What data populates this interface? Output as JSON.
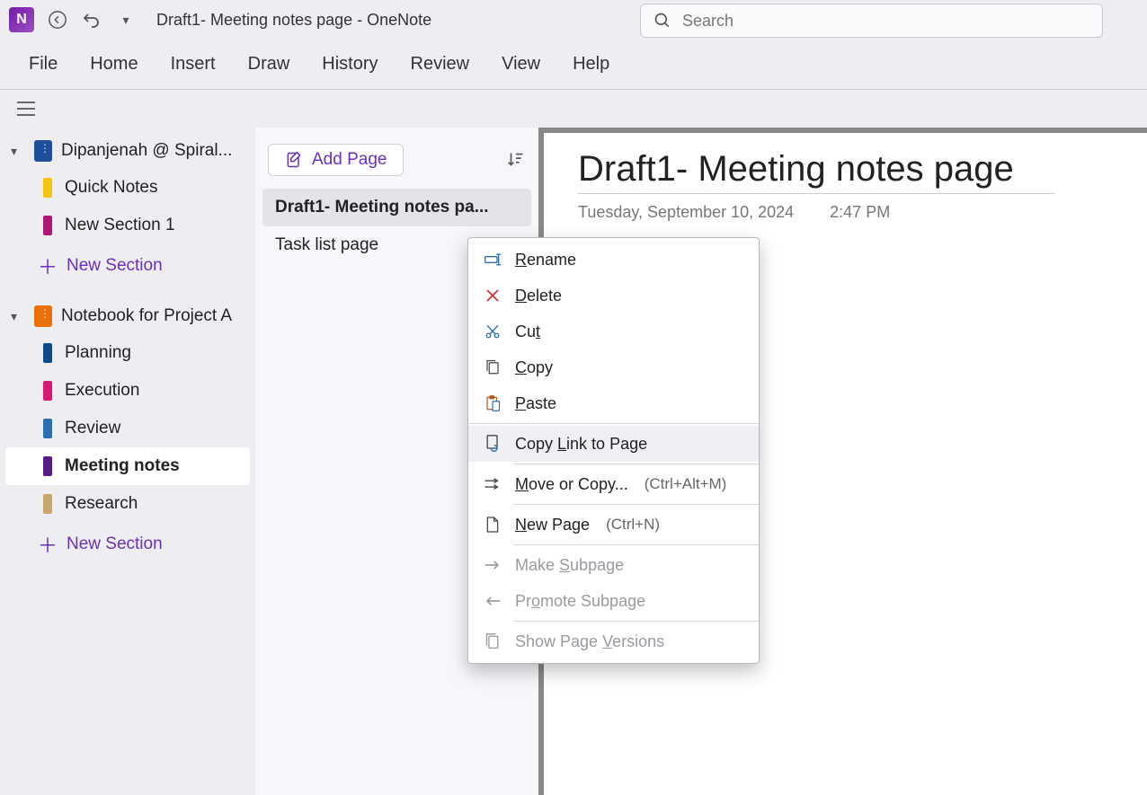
{
  "app": {
    "title": "Draft1- Meeting notes page  -  OneNote"
  },
  "search": {
    "placeholder": "Search"
  },
  "menu": {
    "file": "File",
    "home": "Home",
    "insert": "Insert",
    "draw": "Draw",
    "history": "History",
    "review": "Review",
    "view": "View",
    "help": "Help"
  },
  "sidebar": {
    "notebooks": [
      {
        "name": "Dipanjenah @ Spiral...",
        "color": "#1e4e9c",
        "sections": [
          {
            "label": "Quick Notes",
            "color": "#f2c511"
          },
          {
            "label": "New Section 1",
            "color": "#b01578"
          }
        ]
      },
      {
        "name": "Notebook for Project A",
        "color": "#e8710a",
        "sections": [
          {
            "label": "Planning",
            "color": "#0a4b8a"
          },
          {
            "label": "Execution",
            "color": "#d61a73"
          },
          {
            "label": "Review",
            "color": "#2b6fb3"
          },
          {
            "label": "Meeting notes",
            "color": "#5a1a8a",
            "selected": true
          },
          {
            "label": "Research",
            "color": "#c9a66b"
          }
        ]
      }
    ],
    "new_section": "New Section"
  },
  "pagelist": {
    "add_page": "Add Page",
    "pages": [
      {
        "label": "Draft1- Meeting notes pa...",
        "selected": true
      },
      {
        "label": "Task list page"
      }
    ]
  },
  "page": {
    "title": "Draft1- Meeting notes page",
    "date": "Tuesday, September 10, 2024",
    "time": "2:47 PM"
  },
  "context_menu": {
    "items": [
      {
        "label": "Rename",
        "u": "R",
        "icon": "rename"
      },
      {
        "label": "Delete",
        "u": "D",
        "icon": "delete"
      },
      {
        "label": "Cut",
        "u": "t",
        "icon": "cut"
      },
      {
        "label": "Copy",
        "u": "C",
        "icon": "copy"
      },
      {
        "label": "Paste",
        "u": "P",
        "icon": "paste"
      },
      {
        "sep": true
      },
      {
        "label": "Copy Link to Page",
        "u": "L",
        "icon": "link",
        "hover": true
      },
      {
        "sep": true,
        "short": true
      },
      {
        "label": "Move or Copy...",
        "u": "M",
        "icon": "move",
        "shortcut": "(Ctrl+Alt+M)"
      },
      {
        "sep": true,
        "short": true
      },
      {
        "label": "New Page",
        "u": "N",
        "icon": "newpage",
        "shortcut": "(Ctrl+N)"
      },
      {
        "sep": true,
        "short": true
      },
      {
        "label": "Make Subpage",
        "u": "S",
        "icon": "indent",
        "disabled": true
      },
      {
        "label": "Promote Subpage",
        "u": "o",
        "icon": "outdent",
        "disabled": true
      },
      {
        "sep": true,
        "short": true
      },
      {
        "label": "Show Page Versions",
        "u": "V",
        "icon": "versions",
        "disabled": true
      }
    ]
  }
}
